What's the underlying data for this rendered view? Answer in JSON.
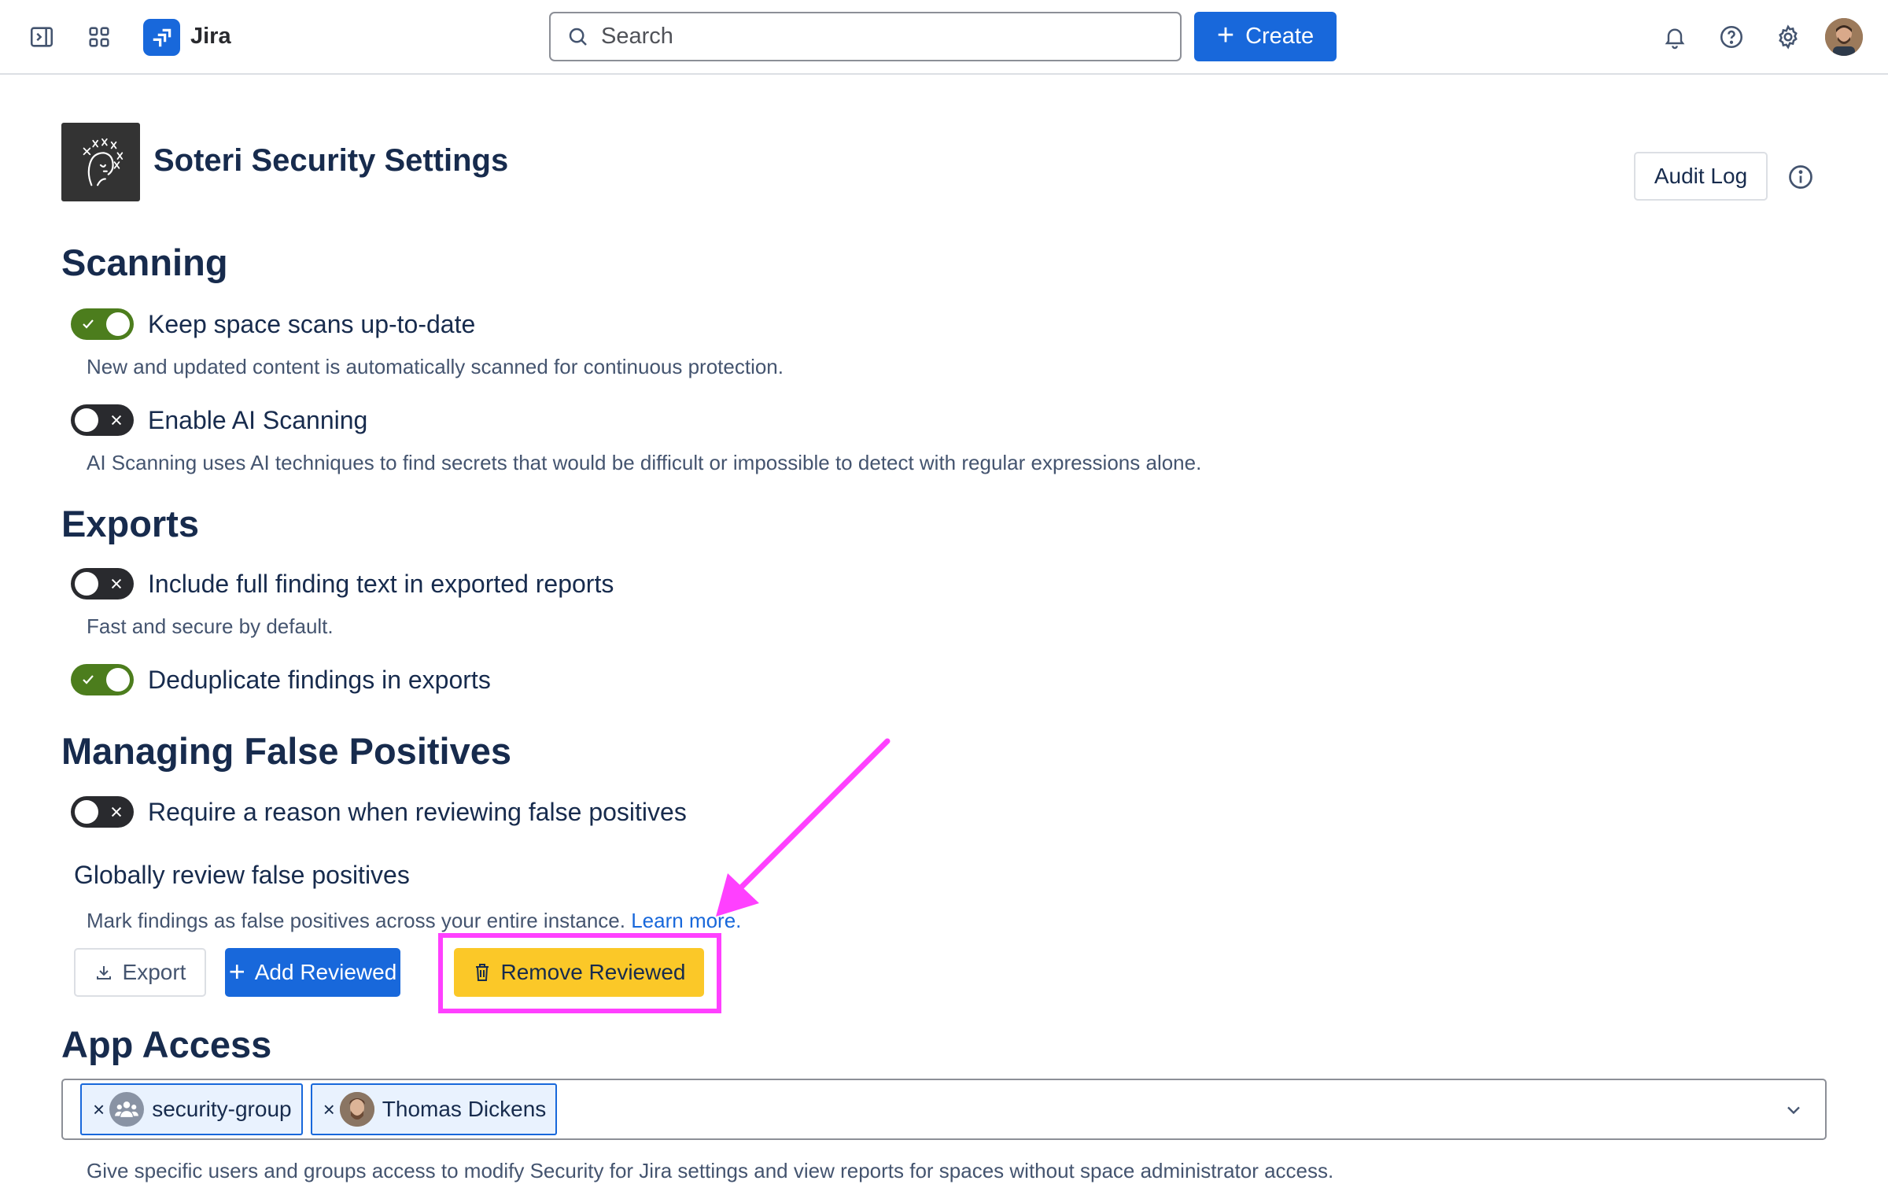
{
  "topnav": {
    "app_name": "Jira",
    "search_placeholder": "Search",
    "create_label": "Create"
  },
  "header": {
    "title": "Soteri Security Settings",
    "audit_log_label": "Audit Log"
  },
  "scanning": {
    "heading": "Scanning",
    "keep_scans": {
      "label": "Keep space scans up-to-date",
      "enabled": true,
      "description": "New and updated content is automatically scanned for continuous protection."
    },
    "ai_scanning": {
      "label": "Enable AI Scanning",
      "enabled": false,
      "description": "AI Scanning uses AI techniques to find secrets that would be difficult or impossible to detect with regular expressions alone."
    }
  },
  "exports": {
    "heading": "Exports",
    "full_text": {
      "label": "Include full finding text in exported reports",
      "enabled": false,
      "description": "Fast and secure by default."
    },
    "dedupe": {
      "label": "Deduplicate findings in exports",
      "enabled": true
    }
  },
  "false_positives": {
    "heading": "Managing False Positives",
    "require_reason": {
      "label": "Require a reason when reviewing false positives",
      "enabled": false
    },
    "global_review": {
      "title": "Globally review false positives",
      "description": "Mark findings as false positives across your entire instance.",
      "learn_more": "Learn more."
    },
    "buttons": {
      "export": "Export",
      "add_reviewed": "Add Reviewed",
      "remove_reviewed": "Remove Reviewed"
    }
  },
  "app_access": {
    "heading": "App Access",
    "chips": [
      {
        "label": "security-group",
        "type": "group"
      },
      {
        "label": "Thomas Dickens",
        "type": "user"
      }
    ],
    "description": "Give specific users and groups access to modify Security for Jira settings and view reports for spaces without space administrator access."
  },
  "colors": {
    "brand_blue": "#1868db",
    "toggle_on": "#4c7d1d",
    "toggle_off": "#292a2e",
    "warning_button": "#fbc828",
    "annotation_magenta": "#ff40ff"
  }
}
